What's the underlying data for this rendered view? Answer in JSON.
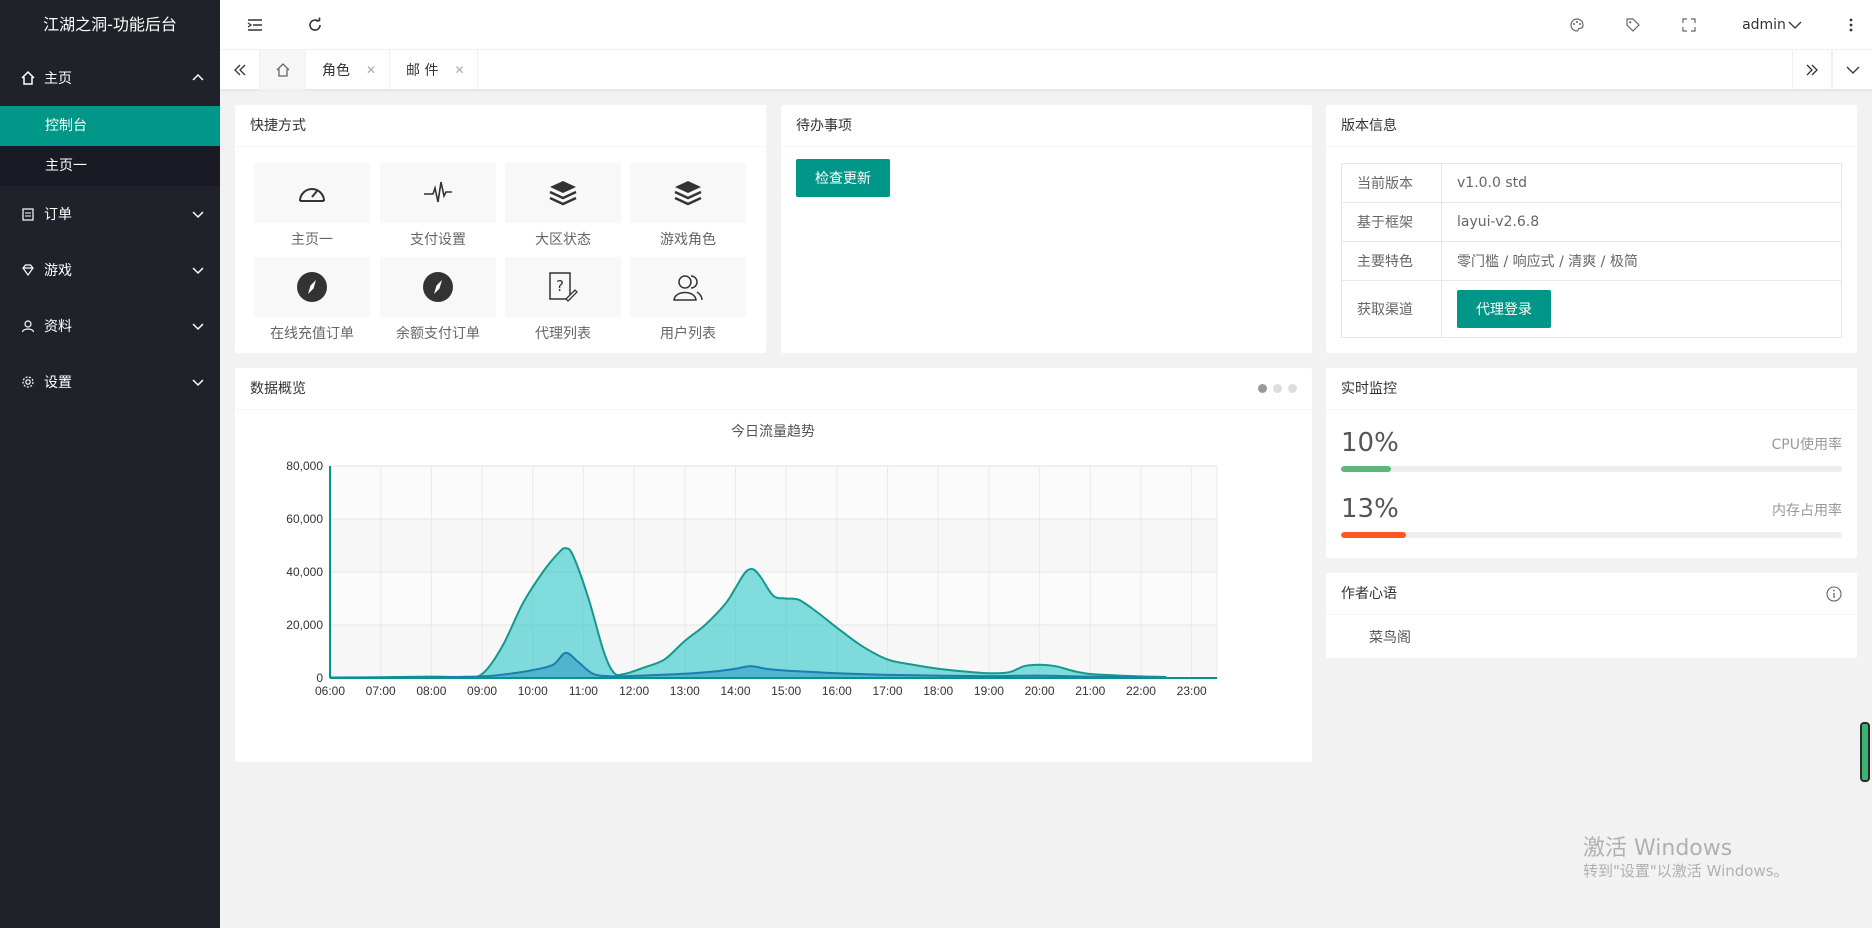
{
  "sidebar": {
    "logo": "江湖之洞-功能后台",
    "home": {
      "label": "主页",
      "icon": "home-icon"
    },
    "home_sub": [
      "控制台",
      "主页一"
    ],
    "items": [
      {
        "label": "订单",
        "icon": "clipboard-icon"
      },
      {
        "label": "游戏",
        "icon": "diamond-icon"
      },
      {
        "label": "资料",
        "icon": "user-icon"
      },
      {
        "label": "设置",
        "icon": "gear-icon"
      }
    ]
  },
  "header": {
    "user": "admin"
  },
  "tabs": [
    {
      "label": "角色"
    },
    {
      "label": "邮 件"
    }
  ],
  "shortcuts": {
    "title": "快捷方式",
    "items": [
      "主页一",
      "支付设置",
      "大区状态",
      "游戏角色",
      "在线充值订单",
      "余额支付订单",
      "代理列表",
      "用户列表"
    ]
  },
  "todo": {
    "title": "待办事项",
    "button": "检查更新"
  },
  "version": {
    "title": "版本信息",
    "rows": [
      {
        "k": "当前版本",
        "v": "v1.0.0 std"
      },
      {
        "k": "基于框架",
        "v": "layui-v2.6.8"
      },
      {
        "k": "主要特色",
        "v": "零门槛 / 响应式 / 清爽 / 极简"
      },
      {
        "k": "获取渠道",
        "v": "代理登录"
      }
    ]
  },
  "overview": {
    "title": "数据概览"
  },
  "monitor": {
    "title": "实时监控",
    "cpu": {
      "pct": "10%",
      "label": "CPU使用率",
      "value": 0.1,
      "color": "#5fb878"
    },
    "mem": {
      "pct": "13%",
      "label": "内存占用率",
      "value": 0.13,
      "color": "#ff5722"
    }
  },
  "author": {
    "title": "作者心语",
    "text": "菜鸟阁"
  },
  "watermark": {
    "line1": "激活 Windows",
    "line2": "转到\"设置\"以激活 Windows。"
  },
  "chart_data": {
    "type": "area",
    "title": "今日流量趋势",
    "x": [
      "06:00",
      "07:00",
      "08:00",
      "09:00",
      "10:00",
      "11:00",
      "12:00",
      "13:00",
      "14:00",
      "15:00",
      "16:00",
      "17:00",
      "18:00",
      "19:00",
      "20:00",
      "21:00",
      "22:00",
      "23:00"
    ],
    "ylim": [
      0,
      80000
    ],
    "yticks": [
      0,
      20000,
      40000,
      60000,
      80000
    ],
    "ytick_labels": [
      "0",
      "20,000",
      "40,000",
      "60,000",
      "80,000"
    ],
    "series": [
      {
        "color": "#2ec7c9",
        "points": [
          [
            0,
            200
          ],
          [
            1,
            300
          ],
          [
            2,
            500
          ],
          [
            2.6,
            400
          ],
          [
            3,
            1500
          ],
          [
            3.4,
            12000
          ],
          [
            3.8,
            28000
          ],
          [
            4.2,
            40000
          ],
          [
            4.5,
            47000
          ],
          [
            4.65,
            49000
          ],
          [
            4.8,
            46000
          ],
          [
            5.1,
            30000
          ],
          [
            5.4,
            10000
          ],
          [
            5.6,
            2000
          ],
          [
            5.8,
            1500
          ],
          [
            6.2,
            4000
          ],
          [
            6.6,
            7000
          ],
          [
            7,
            14000
          ],
          [
            7.4,
            20000
          ],
          [
            7.8,
            28000
          ],
          [
            8,
            34000
          ],
          [
            8.2,
            40000
          ],
          [
            8.35,
            41000
          ],
          [
            8.5,
            38000
          ],
          [
            8.75,
            31000
          ],
          [
            9,
            30000
          ],
          [
            9.25,
            29500
          ],
          [
            9.6,
            25000
          ],
          [
            10,
            19000
          ],
          [
            10.5,
            12000
          ],
          [
            11,
            7000
          ],
          [
            11.5,
            5000
          ],
          [
            12,
            3500
          ],
          [
            12.5,
            2500
          ],
          [
            13,
            1800
          ],
          [
            13.4,
            2200
          ],
          [
            13.7,
            4500
          ],
          [
            14,
            5000
          ],
          [
            14.3,
            4500
          ],
          [
            14.7,
            2500
          ],
          [
            15,
            1500
          ],
          [
            15.5,
            1000
          ],
          [
            16,
            600
          ],
          [
            16.5,
            400
          ]
        ]
      },
      {
        "color": "#1f8fbf",
        "points": [
          [
            0,
            100
          ],
          [
            1,
            200
          ],
          [
            2,
            300
          ],
          [
            3,
            600
          ],
          [
            3.5,
            1500
          ],
          [
            4,
            3000
          ],
          [
            4.4,
            5000
          ],
          [
            4.65,
            9500
          ],
          [
            4.9,
            6000
          ],
          [
            5.2,
            1500
          ],
          [
            5.6,
            600
          ],
          [
            6,
            800
          ],
          [
            7,
            1600
          ],
          [
            7.6,
            2500
          ],
          [
            8,
            3500
          ],
          [
            8.3,
            4500
          ],
          [
            8.6,
            3500
          ],
          [
            9,
            2800
          ],
          [
            9.5,
            2300
          ],
          [
            10,
            1800
          ],
          [
            11,
            1200
          ],
          [
            12,
            900
          ],
          [
            13,
            700
          ],
          [
            14,
            900
          ],
          [
            15,
            500
          ],
          [
            16,
            300
          ],
          [
            16.5,
            200
          ]
        ]
      }
    ]
  }
}
